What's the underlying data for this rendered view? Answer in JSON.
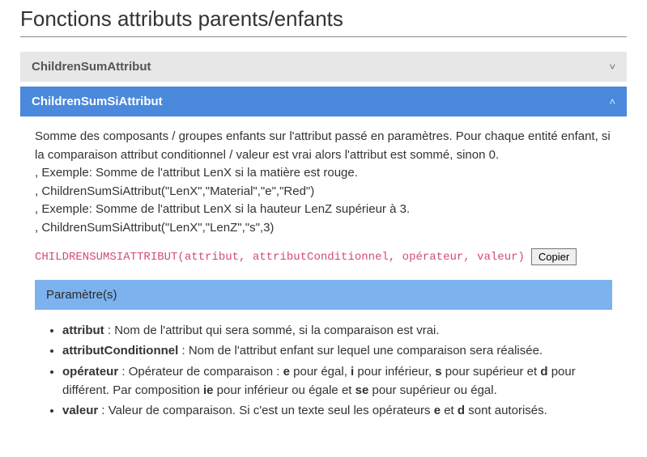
{
  "page": {
    "title": "Fonctions attributs parents/enfants"
  },
  "panels": [
    {
      "title": "ChildrenSumAttribut",
      "chevron": "˅",
      "expanded": false
    },
    {
      "title": "ChildrenSumSiAttribut",
      "chevron": "˄",
      "expanded": true,
      "description": {
        "line1": "Somme des composants / groupes enfants sur l'attribut passé en paramètres. Pour chaque entité enfant, si la comparaison attribut conditionnel / valeur est vrai alors l'attribut est sommé, sinon 0.",
        "line2": ", Exemple: Somme de l'attribut LenX si la matière est rouge.",
        "line3": ", ChildrenSumSiAttribut(\"LenX\",\"Material\",\"e\",\"Red\")",
        "line4": ", Exemple: Somme de l'attribut LenX si la hauteur LenZ supérieur à 3.",
        "line5": ", ChildrenSumSiAttribut(\"LenX\",\"LenZ\",\"s\",3)"
      },
      "signature": "CHILDRENSUMSIATTRIBUT(attribut, attributConditionnel, opérateur, valeur)",
      "copy_label": "Copier",
      "parameters_heading": "Paramètre(s)",
      "parameters": [
        {
          "name": "attribut",
          "sep": " : ",
          "text_parts": [
            "Nom de l'attribut qui sera sommé, si la comparaison est vrai."
          ]
        },
        {
          "name": "attributConditionnel",
          "sep": " : ",
          "text_parts": [
            "Nom de l'attribut enfant sur lequel une comparaison sera réalisée."
          ]
        },
        {
          "name": "opérateur",
          "sep": " : ",
          "text_parts": [
            "Opérateur de comparaison : ",
            {
              "b": "e"
            },
            " pour égal, ",
            {
              "b": "i"
            },
            " pour inférieur, ",
            {
              "b": "s"
            },
            " pour supérieur et ",
            {
              "b": "d"
            },
            " pour différent. Par composition ",
            {
              "b": "ie"
            },
            " pour inférieur ou égale et ",
            {
              "b": "se"
            },
            " pour supérieur ou égal."
          ]
        },
        {
          "name": "valeur",
          "sep": " : ",
          "text_parts": [
            "Valeur de comparaison. Si c'est un texte seul les opérateurs ",
            {
              "b": "e"
            },
            " et ",
            {
              "b": "d"
            },
            " sont autorisés."
          ]
        }
      ]
    }
  ]
}
